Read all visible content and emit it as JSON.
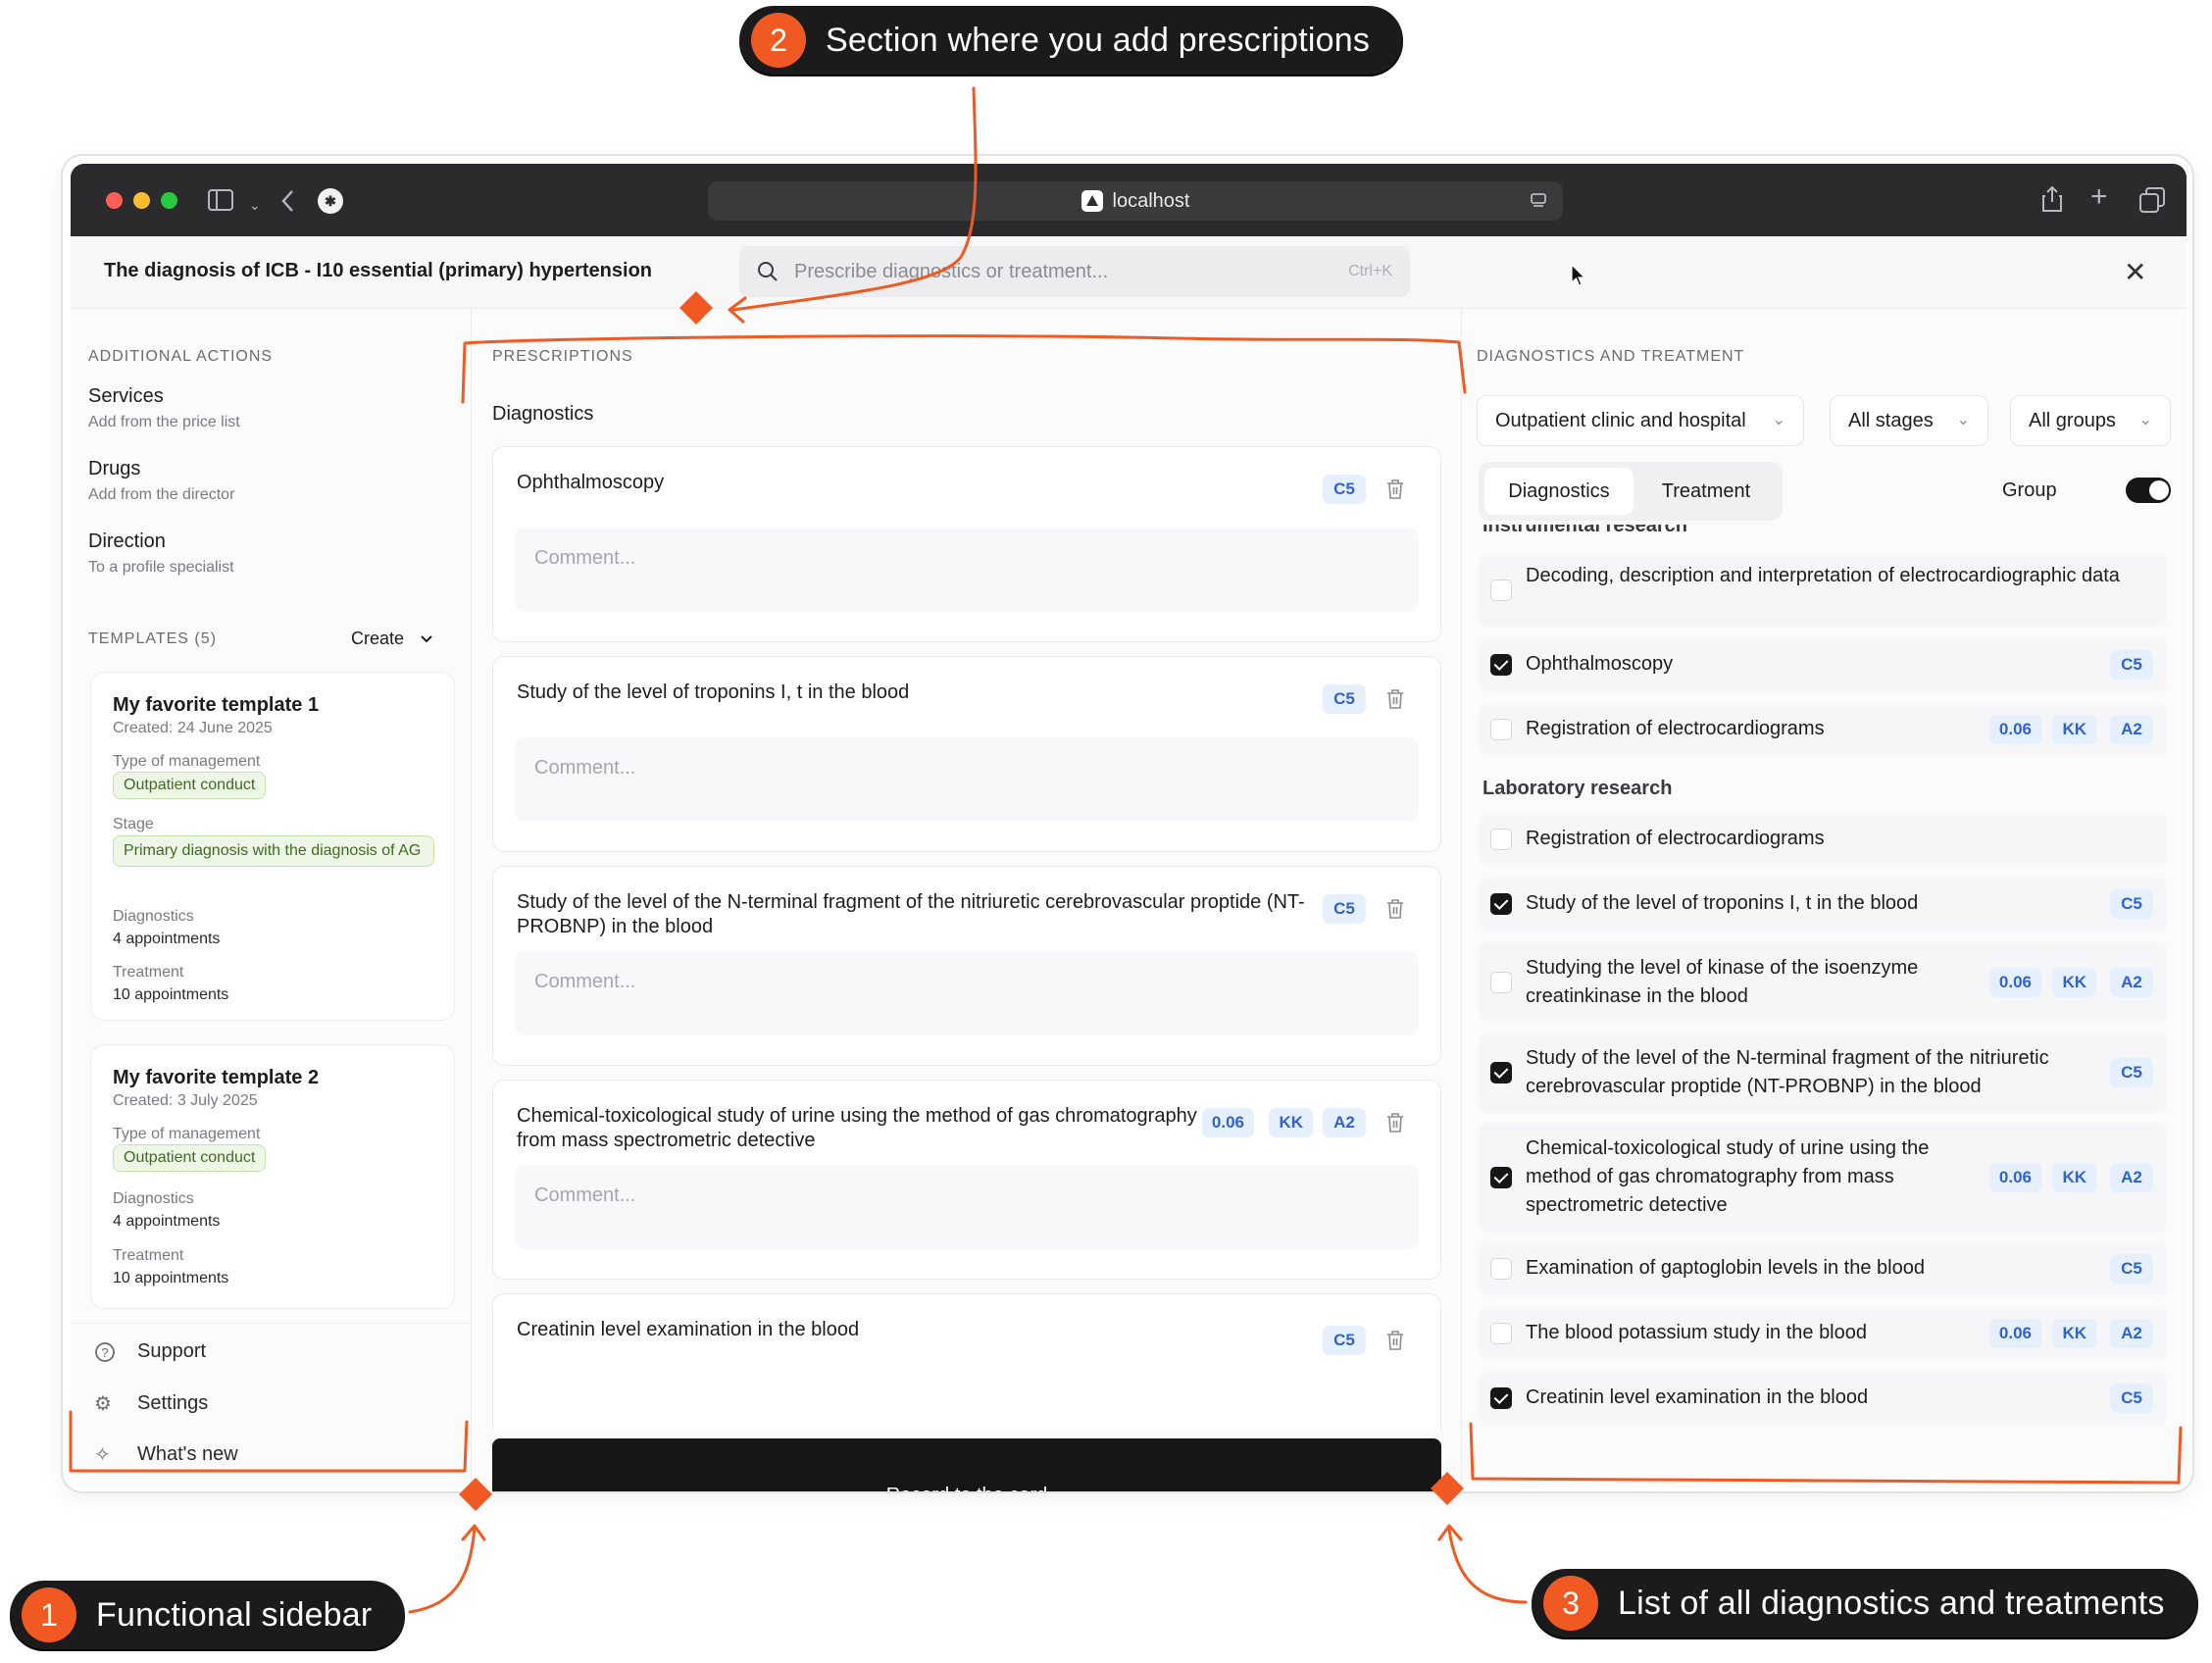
{
  "callouts": {
    "c1": {
      "num": "1",
      "text": "Functional sidebar"
    },
    "c2": {
      "num": "2",
      "text": "Section where you add prescriptions"
    },
    "c3": {
      "num": "3",
      "text": "List of all diagnostics and treatments"
    }
  },
  "colors": {
    "accent": "#f05a22",
    "badge_bg": "#e6effd",
    "badge_text": "#2e63d6",
    "record_bg": "#161616"
  },
  "browser": {
    "url": "localhost"
  },
  "header": {
    "title": "The diagnosis of ICB - I10 essential (primary) hypertension",
    "search_placeholder": "Prescribe diagnostics or treatment...",
    "search_shortcut": "Ctrl+K"
  },
  "sidebar": {
    "actions_heading": "ADDITIONAL ACTIONS",
    "actions": [
      {
        "title": "Services",
        "sub": "Add from the price list"
      },
      {
        "title": "Drugs",
        "sub": "Add from the director"
      },
      {
        "title": "Direction",
        "sub": "To a profile specialist"
      }
    ],
    "templates_heading": "TEMPLATES (5)",
    "create_label": "Create",
    "templates": [
      {
        "name": "My favorite template 1",
        "created": "Created: 24 June 2025",
        "type_label": "Type of management",
        "type_value": "Outpatient conduct",
        "stage_label": "Stage",
        "stage_value": "Primary diagnosis with the diagnosis of AG",
        "diag_label": "Diagnostics",
        "diag_value": "4 appointments",
        "treat_label": "Treatment",
        "treat_value": "10 appointments"
      },
      {
        "name": "My favorite template 2",
        "created": "Created: 3 July 2025",
        "type_label": "Type of management",
        "type_value": "Outpatient conduct",
        "diag_label": "Diagnostics",
        "diag_value": "4 appointments",
        "treat_label": "Treatment",
        "treat_value": "10 appointments"
      }
    ],
    "footer": [
      {
        "label": "Support",
        "icon": "question-circle-icon"
      },
      {
        "label": "Settings",
        "icon": "gear-icon"
      },
      {
        "label": "What's new",
        "icon": "sparkle-icon"
      }
    ]
  },
  "prescriptions": {
    "heading": "PRESCRIPTIONS",
    "subheading": "Diagnostics",
    "comment_placeholder": "Comment...",
    "items": [
      {
        "name": "Ophthalmoscopy",
        "badges": [
          "C5"
        ]
      },
      {
        "name": "Study of the level of troponins I, t in the blood",
        "badges": [
          "C5"
        ]
      },
      {
        "name": "Study of the level of the N-terminal fragment of the nitriuretic cerebrovascular proptide (NT-PROBNP) in the blood",
        "badges": [
          "C5"
        ]
      },
      {
        "name": "Chemical-toxicological study of urine using the method of gas chromatography from mass spectrometric detective",
        "badges": [
          "0.06",
          "KK",
          "A2"
        ]
      },
      {
        "name": "Creatinin level examination in the blood",
        "badges": [
          "C5"
        ]
      }
    ],
    "record_button": "Record to the card"
  },
  "catalog": {
    "heading": "DIAGNOSTICS AND TREATMENT",
    "filters": {
      "type": "Outpatient clinic and hospital",
      "stage": "All stages",
      "group": "All groups"
    },
    "tabs": [
      "Diagnostics",
      "Treatment"
    ],
    "group_label": "Group",
    "group_on": true,
    "partial_heading": "Instrumental research",
    "instrumental": [
      {
        "name": "Decoding, description and interpretation of electrocardiographic data",
        "checked": false,
        "badges": []
      },
      {
        "name": "Ophthalmoscopy",
        "checked": true,
        "badges": [
          "C5"
        ]
      },
      {
        "name": "Registration of electrocardiograms",
        "checked": false,
        "badges": [
          "0.06",
          "KK",
          "A2"
        ]
      }
    ],
    "lab_heading": "Laboratory research",
    "laboratory": [
      {
        "name": "Registration of electrocardiograms",
        "checked": false,
        "badges": []
      },
      {
        "name": "Study of the level of troponins I, t in the blood",
        "checked": true,
        "badges": [
          "C5"
        ]
      },
      {
        "name": "Studying the level of kinase of the isoenzyme creatinkinase in the blood",
        "checked": false,
        "badges": [
          "0.06",
          "KK",
          "A2"
        ]
      },
      {
        "name": "Study of the level of the N-terminal fragment of the nitriuretic cerebrovascular proptide (NT-PROBNP) in the blood",
        "checked": true,
        "badges": [
          "C5"
        ]
      },
      {
        "name": "Chemical-toxicological study of urine using the method of gas chromatography from mass spectrometric detective",
        "checked": true,
        "badges": [
          "0.06",
          "KK",
          "A2"
        ]
      },
      {
        "name": "Examination of gaptoglobin levels in the blood",
        "checked": false,
        "badges": [
          "C5"
        ]
      },
      {
        "name": "The blood potassium study in the blood",
        "checked": false,
        "badges": [
          "0.06",
          "KK",
          "A2"
        ]
      },
      {
        "name": "Creatinin level examination in the blood",
        "checked": true,
        "badges": [
          "C5"
        ]
      }
    ]
  }
}
